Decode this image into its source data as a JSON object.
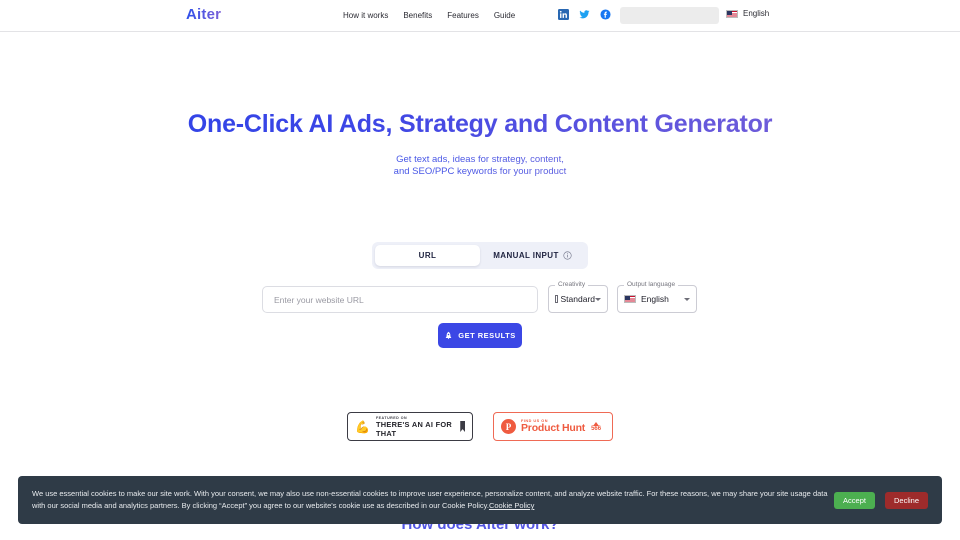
{
  "header": {
    "logo": "Aiter",
    "nav": [
      {
        "label": "How it works"
      },
      {
        "label": "Benefits"
      },
      {
        "label": "Features"
      },
      {
        "label": "Guide"
      }
    ],
    "social": [
      {
        "name": "linkedin-icon",
        "color": "#2867B2"
      },
      {
        "name": "twitter-icon",
        "color": "#1DA1F2"
      },
      {
        "name": "facebook-icon",
        "color": "#1877F2"
      }
    ],
    "language": {
      "label": "English",
      "flag": "us-flag-icon"
    }
  },
  "hero": {
    "title": "One-Click AI Ads, Strategy and Content Generator",
    "subtitle_line1": "Get text ads, ideas for strategy, content,",
    "subtitle_line2": "and SEO/PPC keywords for your product",
    "title_gradient_from": "#2b44e8",
    "title_gradient_to": "#8164d4"
  },
  "form": {
    "tabs": [
      {
        "label": "URL",
        "active": true
      },
      {
        "label": "MANUAL INPUT",
        "active": false,
        "icon": "info-icon"
      }
    ],
    "url_placeholder": "Enter your website URL",
    "url_value": "",
    "creativity": {
      "label": "Creativity",
      "value": "Standard"
    },
    "output_language": {
      "label": "Output language",
      "value": "English"
    },
    "submit": {
      "label": "GET RESULTS",
      "icon": "rocket-icon",
      "color": "#3b47e5"
    }
  },
  "badges": {
    "taft": {
      "eyebrow": "FEATURED ON",
      "title": "THERE'S AN AI FOR THAT"
    },
    "product_hunt": {
      "eyebrow": "FIND US ON",
      "title": "Product Hunt",
      "count": "566"
    }
  },
  "section": {
    "how_heading": "How does Aiter work?"
  },
  "cookie_banner": {
    "text": "We use essential cookies to make our site work. With your consent, we may also use non-essential cookies to improve user experience, personalize content, and analyze website traffic. For these reasons, we may share your site usage data with our social media and analytics partners. By clicking “Accept” you agree to our website's cookie use as described in our Cookie Policy.",
    "link_label": "Cookie Policy",
    "accept_label": "Accept",
    "decline_label": "Decline",
    "accept_color": "#4caf50",
    "decline_color": "#9e2b2b",
    "background": "#2f3b47"
  }
}
